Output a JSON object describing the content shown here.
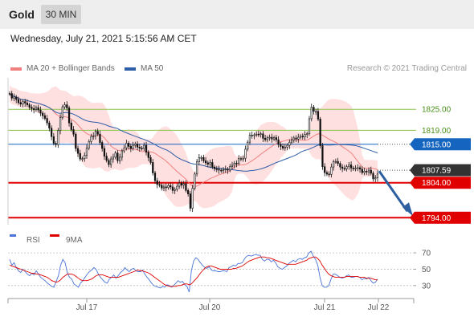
{
  "header": {
    "symbol": "Gold",
    "timeframe": "30 MIN",
    "datetime": "Wednesday, July 21, 2021 5:15:56 AM CET"
  },
  "legend": {
    "ma20_label": "MA 20 + Bollinger Bands",
    "ma50_label": "MA 50",
    "credit": "Research © 2021 Trading Central",
    "rsi_label": "RSI",
    "rsi9_label": "9MA"
  },
  "colors": {
    "bollinger": "#ffd6d6",
    "ma20": "#f08080",
    "ma50": "#2f5ea8",
    "candle": "#111111",
    "resistance": "#8bc34a",
    "pivot": "#1565c0",
    "support": "#e00000",
    "last": "#333333",
    "arrow": "#2d5ea0",
    "rsi": "#4a74d8",
    "rsi_ma": "#e00000"
  },
  "chart_data": {
    "type": "candlestick",
    "price_range": [
      1792,
      1834
    ],
    "levels": [
      {
        "value": 1825.0,
        "label": "1825.00",
        "kind": "resistance"
      },
      {
        "value": 1819.0,
        "label": "1819.00",
        "kind": "resistance"
      },
      {
        "value": 1815.0,
        "label": "1815.00",
        "kind": "pivot"
      },
      {
        "value": 1807.59,
        "label": "1807.59",
        "kind": "last"
      },
      {
        "value": 1804.0,
        "label": "1804.00",
        "kind": "support"
      },
      {
        "value": 1794.0,
        "label": "1794.00",
        "kind": "support"
      }
    ],
    "forecast_arrow": {
      "from": 1808,
      "to": 1794
    },
    "x_labels": [
      "Jul 17",
      "Jul 20",
      "Jul 21",
      "Jul 22"
    ],
    "close": [
      1829.5,
      1828.2,
      1828.5,
      1827.8,
      1826.9,
      1826.5,
      1827.2,
      1826.8,
      1826.3,
      1825.6,
      1825.2,
      1824.9,
      1825.5,
      1824.8,
      1823.9,
      1823.2,
      1822.4,
      1821.1,
      1819.6,
      1817.2,
      1815.3,
      1814.9,
      1818.9,
      1822.6,
      1825.7,
      1826.3,
      1825.4,
      1821.1,
      1819.2,
      1817.9,
      1813.8,
      1812.4,
      1810.8,
      1810.9,
      1811.9,
      1813.9,
      1815.8,
      1817.2,
      1817.4,
      1818.7,
      1817.9,
      1815.5,
      1813.8,
      1811.6,
      1810.4,
      1809.2,
      1810.8,
      1811.3,
      1812.5,
      1810.3,
      1811.3,
      1813.1,
      1814.0,
      1815.3,
      1814.4,
      1813.8,
      1814.7,
      1815.1,
      1814.2,
      1813.9,
      1813.8,
      1814.7,
      1812.7,
      1811.2,
      1809.8,
      1806.8,
      1804.6,
      1803.5,
      1803.3,
      1802.5,
      1802.8,
      1802.6,
      1803.2,
      1802.8,
      1801.8,
      1802.1,
      1803.0,
      1803.9,
      1803.3,
      1803.7,
      1801.8,
      1800.8,
      1796.7,
      1802.4,
      1806.5,
      1810.0,
      1811.2,
      1811.2,
      1810.3,
      1809.7,
      1809.3,
      1809.8,
      1808.5,
      1808.0,
      1807.9,
      1807.6,
      1807.4,
      1807.7,
      1807.9,
      1807.6,
      1808.6,
      1809.0,
      1809.6,
      1809.5,
      1810.9,
      1810.9,
      1811.0,
      1813.6,
      1815.6,
      1817.6,
      1817.5,
      1817.7,
      1817.9,
      1817.8,
      1818.0,
      1816.7,
      1816.3,
      1816.9,
      1817.0,
      1816.5,
      1816.9,
      1816.3,
      1815.0,
      1814.4,
      1813.9,
      1814.2,
      1814.7,
      1815.6,
      1816.2,
      1816.8,
      1816.5,
      1817.0,
      1817.3,
      1817.1,
      1817.8,
      1818.0,
      1822.3,
      1825.6,
      1824.4,
      1824.4,
      1822.2,
      1814.6,
      1808.6,
      1806.9,
      1806.5,
      1806.4,
      1808.5,
      1810.0,
      1810.1,
      1809.5,
      1808.5,
      1808.1,
      1808.0,
      1808.6,
      1809.1,
      1808.2,
      1808.0,
      1808.2,
      1808.3,
      1807.9,
      1806.9,
      1807.3,
      1807.1,
      1807.6,
      1806.7,
      1805.1,
      1805.4,
      1806.5
    ],
    "rsi": [
      62,
      55,
      58,
      52,
      48,
      46,
      50,
      47,
      44,
      42,
      45,
      43,
      48,
      44,
      40,
      38,
      36,
      33,
      31,
      29,
      28,
      35,
      42,
      55,
      62,
      58,
      46,
      40,
      38,
      32,
      30,
      28,
      33,
      36,
      40,
      44,
      47,
      49,
      52,
      50,
      44,
      40,
      37,
      34,
      33,
      38,
      40,
      43,
      39,
      42,
      46,
      48,
      52,
      49,
      47,
      50,
      51,
      48,
      47,
      47,
      49,
      44,
      40,
      37,
      33,
      30,
      29,
      28,
      27,
      29,
      28,
      31,
      30,
      28,
      30,
      33,
      36,
      34,
      35,
      31,
      29,
      22,
      48,
      60,
      64,
      62,
      58,
      55,
      52,
      51,
      53,
      49,
      48,
      48,
      47,
      47,
      48,
      48,
      47,
      52,
      53,
      55,
      54,
      57,
      57,
      58,
      63,
      66,
      67,
      66,
      67,
      68,
      67,
      67,
      62,
      60,
      62,
      62,
      59,
      61,
      58,
      53,
      51,
      50,
      52,
      54,
      57,
      59,
      61,
      59,
      62,
      63,
      62,
      64,
      65,
      70,
      72,
      66,
      62,
      55,
      40,
      30,
      28,
      28,
      30,
      38,
      44,
      44,
      42,
      40,
      39,
      40,
      42,
      43,
      40,
      40,
      41,
      41,
      40,
      37,
      39,
      38,
      40,
      36,
      33,
      34,
      38
    ],
    "rsi_ma": [
      55,
      54,
      53,
      52,
      51,
      50,
      49,
      48,
      47,
      46,
      45,
      45,
      44,
      44,
      43,
      42,
      41,
      40,
      38,
      36,
      35,
      34,
      35,
      37,
      40,
      42,
      44,
      44,
      44,
      43,
      41,
      39,
      37,
      36,
      36,
      36,
      37,
      38,
      40,
      42,
      43,
      43,
      43,
      42,
      41,
      40,
      40,
      40,
      40,
      40,
      41,
      42,
      43,
      44,
      45,
      46,
      47,
      48,
      49,
      48,
      48,
      47,
      46,
      45,
      43,
      41,
      39,
      37,
      35,
      33,
      31,
      30,
      29,
      29,
      29,
      29,
      30,
      30,
      31,
      32,
      32,
      31,
      32,
      35,
      38,
      41,
      45,
      48,
      51,
      53,
      54,
      54,
      53,
      52,
      51,
      50,
      50,
      50,
      50,
      50,
      50,
      51,
      51,
      52,
      53,
      54,
      56,
      58,
      60,
      61,
      62,
      63,
      64,
      65,
      65,
      65,
      64,
      64,
      63,
      62,
      61,
      60,
      59,
      58,
      57,
      56,
      56,
      56,
      56,
      56,
      57,
      58,
      59,
      60,
      61,
      63,
      64,
      65,
      65,
      63,
      60,
      55,
      51,
      47,
      44,
      42,
      41,
      40,
      40,
      40,
      40,
      40,
      41,
      41,
      41,
      41,
      41,
      41,
      40,
      40,
      40,
      39,
      39,
      39,
      38,
      37,
      37
    ],
    "rsi_ticks": [
      "70",
      "50",
      "30"
    ]
  }
}
